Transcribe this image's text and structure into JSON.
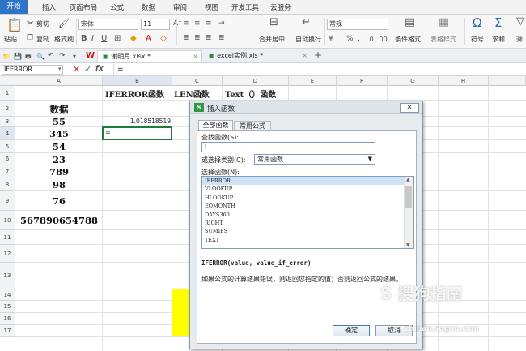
{
  "menu": {
    "tabs": [
      "开始",
      "插入",
      "页面布局",
      "公式",
      "数据",
      "审阅",
      "视图",
      "开发工具",
      "云服务"
    ]
  },
  "ribbon": {
    "paste": "粘贴",
    "cut": "剪切",
    "copy": "复制",
    "format_painter": "格式刷",
    "font_name": "宋体",
    "font_size": "11",
    "merge_center": "合并居中",
    "wrap_text": "自动换行",
    "number_format": "常规",
    "conditional_format": "条件格式",
    "table_style": "表格样式",
    "symbol": "符号",
    "sum": "求和",
    "filter": "筛"
  },
  "doc_tabs": {
    "file1": "谢明月.xlsx *",
    "file2": "excel实例.xls *"
  },
  "formula_bar": {
    "name_box": "IFERROR",
    "fx": "fx",
    "content": "="
  },
  "sheet": {
    "columns": [
      "A",
      "B",
      "C",
      "D",
      "E",
      "F",
      "G",
      "H",
      "I"
    ],
    "rows": [
      "1",
      "2",
      "3",
      "4",
      "5",
      "6",
      "7",
      "8",
      "9",
      "10",
      "11",
      "12",
      "13",
      "14",
      "15",
      "16",
      "17"
    ],
    "b2": "IFERROR函数",
    "c2": "LEN函数",
    "d2": "Text（）函数",
    "a2": "数据",
    "a_values": [
      "55",
      "345",
      "54",
      "23",
      "789",
      "98",
      "76",
      "567890654788"
    ],
    "b3": "1.018518519",
    "b4": "="
  },
  "dialog": {
    "title": "插入函数",
    "tab_all": "全部函数",
    "tab_common": "常用公式",
    "search_label": "查找函数(S):",
    "search_value": "I",
    "category_label": "或选择类别(C):",
    "category_value": "常用函数",
    "select_label": "选择函数(N):",
    "functions": [
      "IFERROR",
      "VLOOKUP",
      "HLOOKUP",
      "EOMONTH",
      "DAYS360",
      "RIGHT",
      "SUMIFS",
      "TEXT"
    ],
    "syntax": "IFERROR(value, value_if_error)",
    "description": "如果公式的计算结果错误，则返回您指定的值；否则返回公式的结果。",
    "ok": "确定",
    "cancel": "取消"
  },
  "watermark": {
    "text": "搜狗指南",
    "url": "zhinan.sogou.com"
  }
}
